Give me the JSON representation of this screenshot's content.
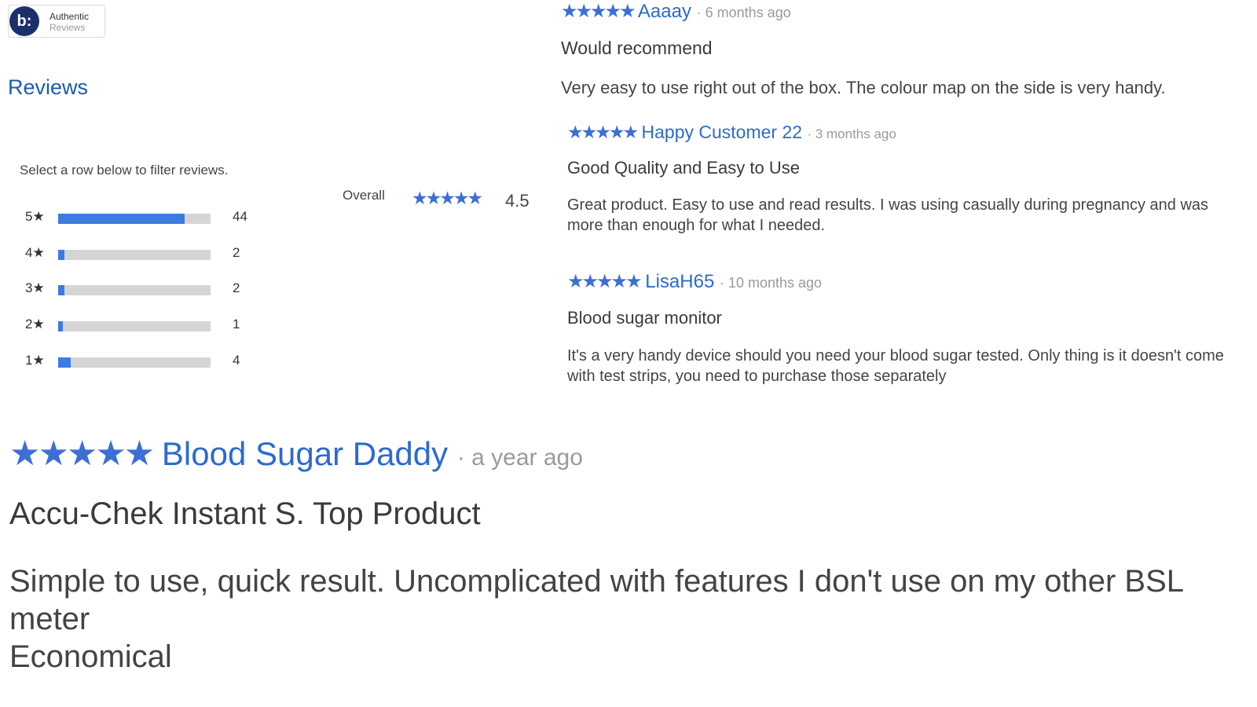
{
  "brand": {
    "logo_glyph": "b:",
    "line1": "Authentic",
    "line2": "Reviews",
    "color": "#1b2f6b"
  },
  "summary": {
    "heading": "Reviews",
    "filter_hint": "Select a row below to filter reviews.",
    "overall_label": "Overall",
    "overall_score": "4.5",
    "overall_stars": "★★★★★",
    "distribution": [
      {
        "label": "5★",
        "count": "44",
        "fraction": 0.83
      },
      {
        "label": "4★",
        "count": "2",
        "fraction": 0.04
      },
      {
        "label": "3★",
        "count": "2",
        "fraction": 0.04
      },
      {
        "label": "2★",
        "count": "1",
        "fraction": 0.02
      },
      {
        "label": "1★",
        "count": "4",
        "fraction": 0.08
      }
    ],
    "accent_color": "#3c7be0"
  },
  "reviews": [
    {
      "stars": "★★★★★",
      "author": "Aaaay",
      "time": "· 6 months ago",
      "title": "Would recommend",
      "body": "Very easy to use right out of the box. The colour map on the side is very handy."
    },
    {
      "stars": "★★★★★",
      "author": "Happy Customer 22",
      "time": "· 3 months ago",
      "title": "Good Quality and Easy to Use",
      "body": "Great product. Easy to use and read results. I was using casually during pregnancy and was more than enough for what I needed."
    },
    {
      "stars": "★★★★★",
      "author": "LisaH65",
      "time": "· 10 months ago",
      "title": "Blood sugar monitor",
      "body": "It's a very handy device should you need your blood sugar tested. Only thing is it doesn't come with test strips, you need to purchase those separately"
    },
    {
      "stars": "★★★★★",
      "author": "Blood Sugar Daddy",
      "time": "· a year ago",
      "title": "Accu-Chek Instant S. Top Product",
      "body_line1": "Simple to use, quick result. Uncomplicated with features I don't use on my other BSL meter",
      "body_line2": "Economical"
    }
  ]
}
